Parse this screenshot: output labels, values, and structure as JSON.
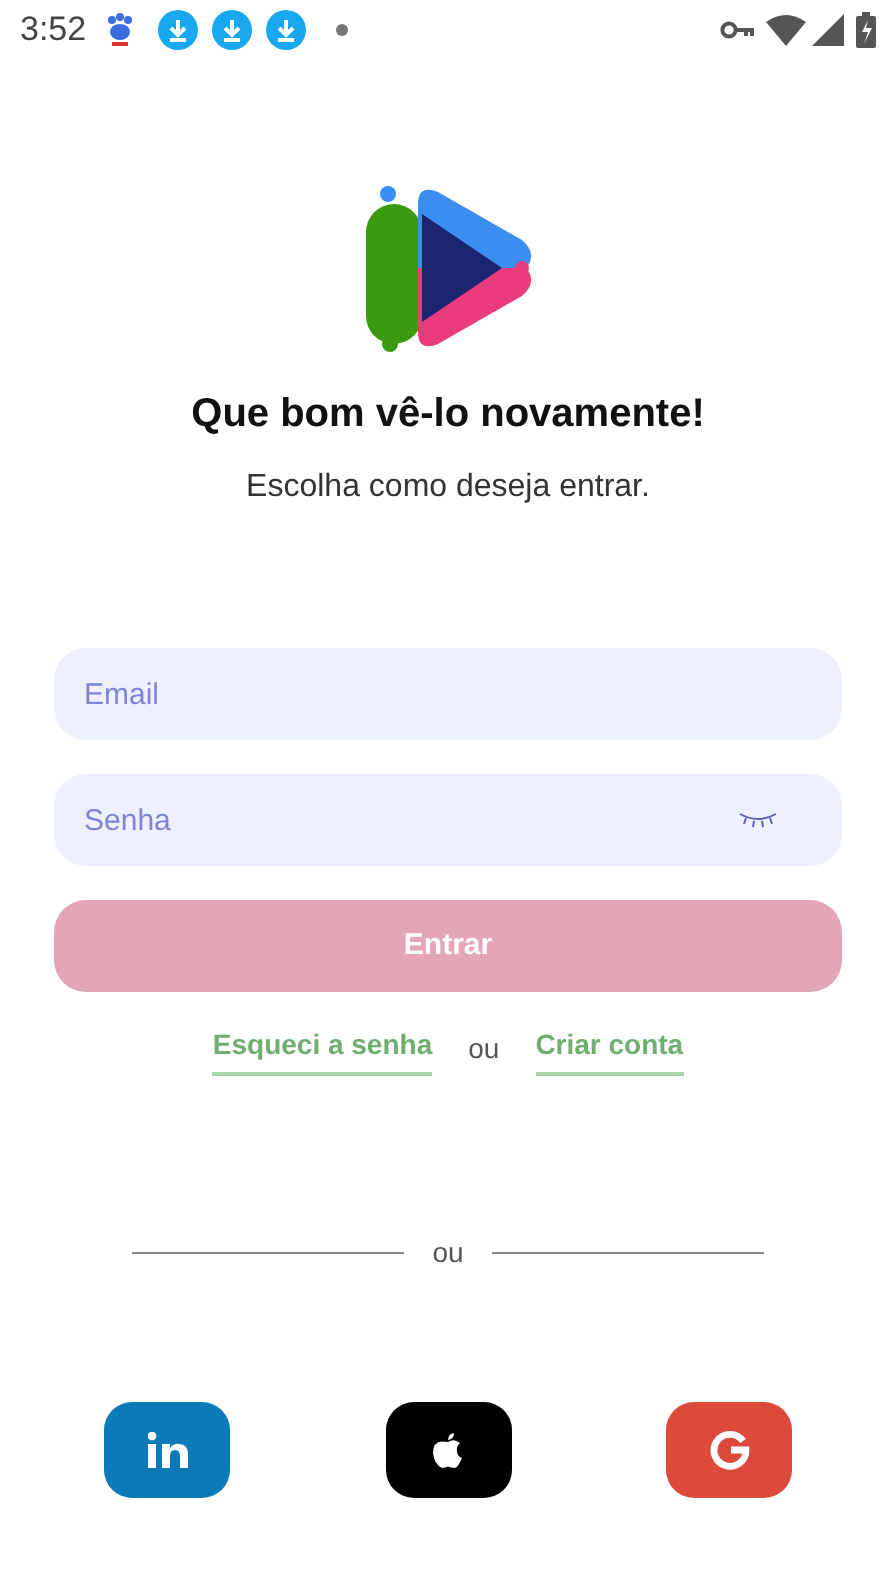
{
  "status_bar": {
    "time": "3:52"
  },
  "header": {
    "title": "Que bom vê-lo novamente!",
    "subtitle": "Escolha como deseja entrar."
  },
  "form": {
    "email": {
      "placeholder": "Email"
    },
    "password": {
      "placeholder": "Senha"
    },
    "submit": {
      "label": "Entrar",
      "disabled": true
    }
  },
  "links": [
    {
      "label": "Esqueci a senha"
    },
    {
      "label": "ou",
      "kind": "separator"
    },
    {
      "label": "Criar conta"
    }
  ],
  "divider": {
    "label": "ou"
  },
  "social": [
    {
      "kind": "linkedin"
    },
    {
      "kind": "apple"
    },
    {
      "kind": "google"
    }
  ]
}
